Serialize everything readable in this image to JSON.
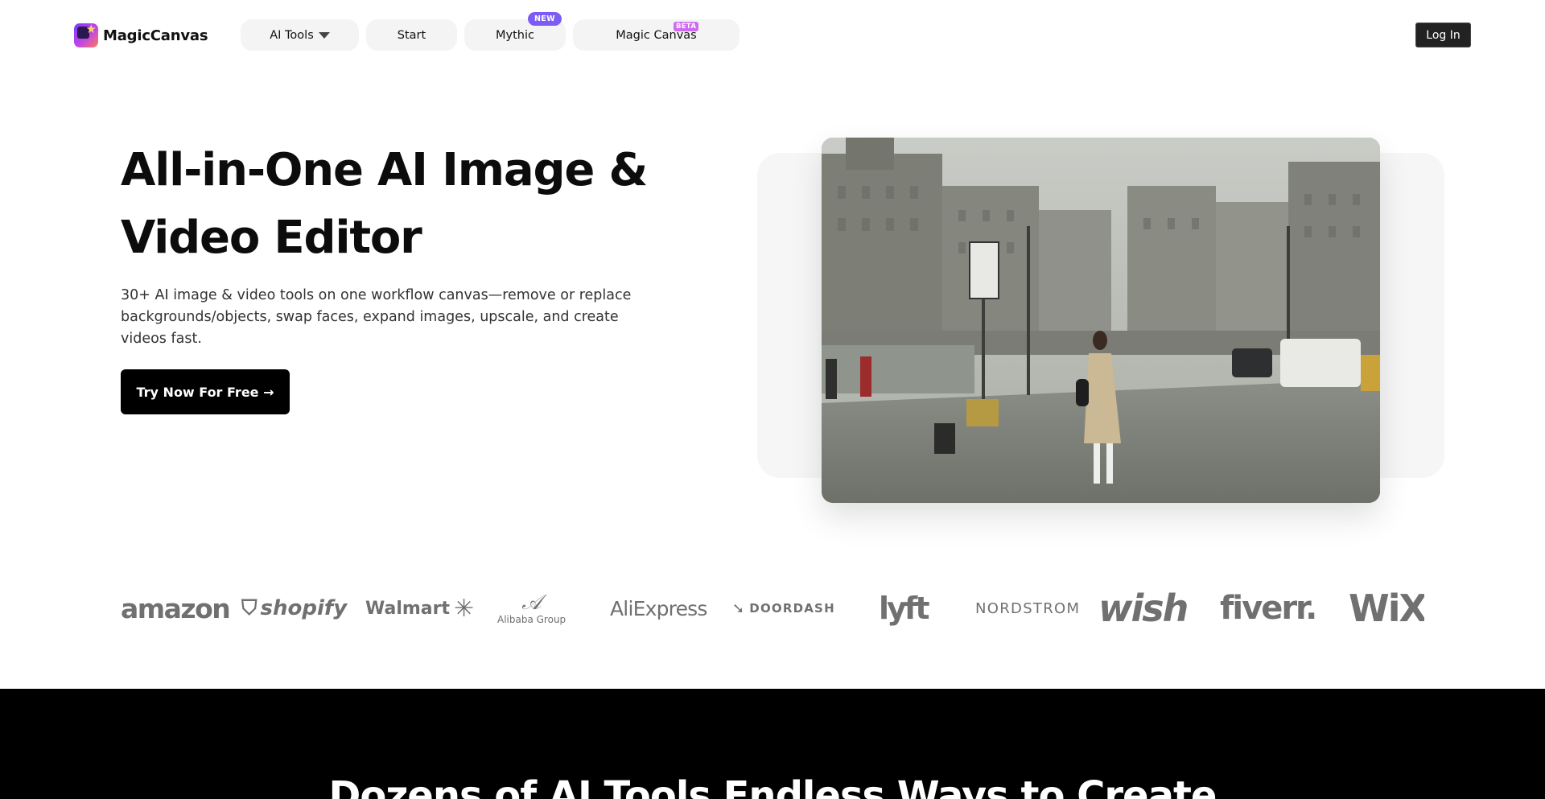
{
  "header": {
    "logo_text": "MagicCanvas",
    "nav": {
      "ai_tools": "AI Tools",
      "start": "Start",
      "mythic": "Mythic",
      "mythic_badge": "NEW",
      "magic_canvas": "Magic Canvas",
      "magic_canvas_badge": "BETA"
    },
    "login": "Log In"
  },
  "hero": {
    "title": "All-in-One AI Image & Video Editor",
    "subtitle": "30+ AI image & video tools on one workflow canvas—remove or replace backgrounds/objects, swap faces, expand images, upscale, and create videos fast.",
    "cta": "Try Now For Free →",
    "media_icon": "city-street-photo"
  },
  "brands": {
    "amazon": "amazon",
    "shopify": "shopify",
    "walmart": "Walmart",
    "alibaba": "Alibaba Group",
    "aliexpress": "AliExpress",
    "doordash": "DOORDASH",
    "lyft": "lyft",
    "nordstrom": "NORDSTROM",
    "wish": "wish",
    "fiverr": "fiverr.",
    "wix": "WiX"
  },
  "section": {
    "title": "Dozens of AI Tools Endless Ways to Create"
  },
  "colors": {
    "new_badge": "#7c5cf5",
    "beta_badge": "#cf6bf0",
    "cta_bg": "#000000",
    "brand_gray": "#707070"
  }
}
